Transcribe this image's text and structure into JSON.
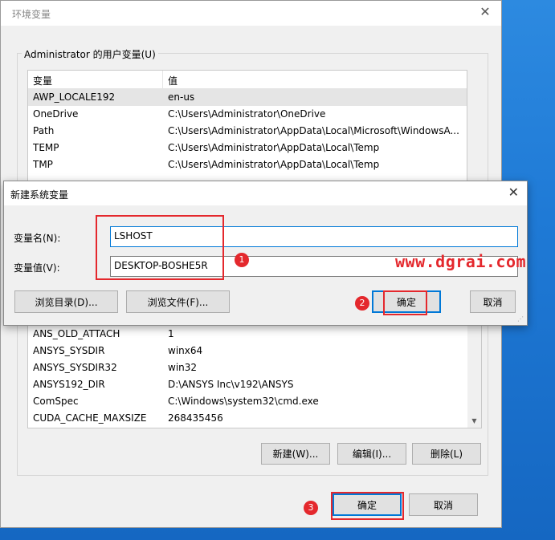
{
  "env_window": {
    "title": "环境变量",
    "user_group_label": "Administrator 的用户变量(U)",
    "user_vars": {
      "col_var": "变量",
      "col_val": "值",
      "rows": [
        {
          "name": "AWP_LOCALE192",
          "value": "en-us"
        },
        {
          "name": "OneDrive",
          "value": "C:\\Users\\Administrator\\OneDrive"
        },
        {
          "name": "Path",
          "value": "C:\\Users\\Administrator\\AppData\\Local\\Microsoft\\WindowsA..."
        },
        {
          "name": "TEMP",
          "value": "C:\\Users\\Administrator\\AppData\\Local\\Temp"
        },
        {
          "name": "TMP",
          "value": "C:\\Users\\Administrator\\AppData\\Local\\Temp"
        }
      ]
    },
    "system_vars": {
      "rows": [
        {
          "name": "ANS_OLD_ATTACH",
          "value": "1"
        },
        {
          "name": "ANSYS_SYSDIR",
          "value": "winx64"
        },
        {
          "name": "ANSYS_SYSDIR32",
          "value": "win32"
        },
        {
          "name": "ANSYS192_DIR",
          "value": "D:\\ANSYS Inc\\v192\\ANSYS"
        },
        {
          "name": "ComSpec",
          "value": "C:\\Windows\\system32\\cmd.exe"
        },
        {
          "name": "CUDA_CACHE_MAXSIZE",
          "value": "268435456"
        }
      ]
    },
    "buttons": {
      "new": "新建(W)...",
      "edit": "编辑(I)...",
      "delete": "删除(L)",
      "ok": "确定",
      "cancel": "取消"
    }
  },
  "dialog": {
    "title": "新建系统变量",
    "name_label": "变量名(N):",
    "name_value": "LSHOST",
    "value_label": "变量值(V):",
    "value_value": "DESKTOP-BOSHE5R",
    "browse_dir": "浏览目录(D)...",
    "browse_file": "浏览文件(F)...",
    "ok": "确定",
    "cancel": "取消"
  },
  "annotations": {
    "step1": "1",
    "step2": "2",
    "step3": "3",
    "watermark": "www.dgrai.com",
    "color": "#e4282d"
  },
  "icons": {
    "close": "close-icon",
    "scroll_up": "scroll-up-arrow-icon",
    "scroll_down": "scroll-down-arrow-icon"
  }
}
